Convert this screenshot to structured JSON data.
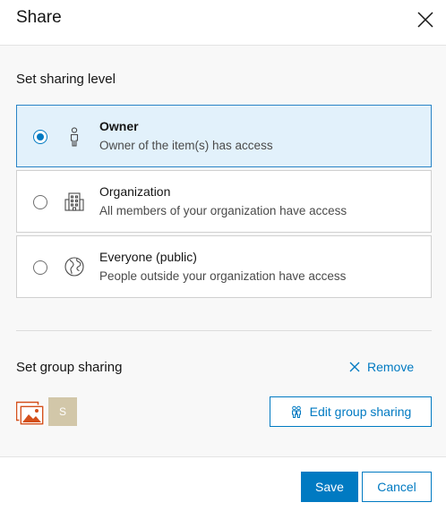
{
  "dialog": {
    "title": "Share",
    "close_icon": "close-icon"
  },
  "sharing_level": {
    "heading": "Set sharing level",
    "selected": "owner",
    "options": [
      {
        "id": "owner",
        "title": "Owner",
        "description": "Owner of the item(s) has access",
        "icon": "user-icon"
      },
      {
        "id": "organization",
        "title": "Organization",
        "description": "All members of your organization have access",
        "icon": "organization-icon"
      },
      {
        "id": "everyone",
        "title": "Everyone (public)",
        "description": "People outside your organization have access",
        "icon": "globe-icon"
      }
    ]
  },
  "group_sharing": {
    "heading": "Set group sharing",
    "remove_label": "Remove",
    "groups": [
      {
        "type": "image-thumbnail",
        "icon": "image-group-icon"
      },
      {
        "type": "avatar",
        "initial": "S"
      }
    ],
    "edit_label": "Edit group sharing"
  },
  "footer": {
    "save_label": "Save",
    "cancel_label": "Cancel"
  },
  "colors": {
    "accent": "#007ac2",
    "selected_background": "#e2f1fb",
    "avatar_background": "#d2c7a9",
    "thumbnail_accent": "#d4501c"
  }
}
